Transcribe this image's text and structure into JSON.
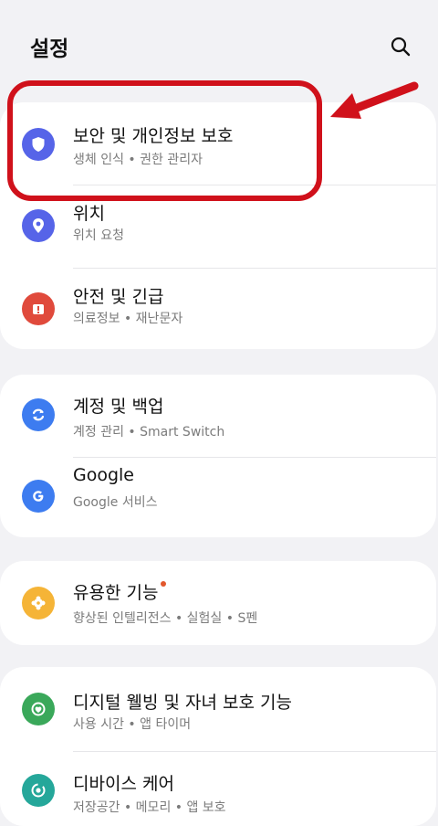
{
  "header": {
    "title": "설정",
    "search_icon": "search-icon"
  },
  "items": [
    {
      "title": "보안 및 개인정보 보호",
      "subtitle": "생체 인식 • 권한 관리자",
      "icon": "shield-icon",
      "color": "#5664e8"
    },
    {
      "title": "위치",
      "subtitle": "위치 요청",
      "icon": "location-pin-icon",
      "color": "#5664e8"
    },
    {
      "title": "안전 및 긴급",
      "subtitle": "의료정보 • 재난문자",
      "icon": "emergency-icon",
      "color": "#e04a3c"
    },
    {
      "title": "계정 및 백업",
      "subtitle": "계정 관리 • Smart Switch",
      "icon": "sync-icon",
      "color": "#3d7cf0"
    },
    {
      "title": "Google",
      "subtitle": "Google 서비스",
      "icon": "google-icon",
      "color": "#3d7cf0"
    },
    {
      "title": "유용한 기능",
      "subtitle": "향상된 인텔리전스 • 실험실 • S펜",
      "icon": "puzzle-icon",
      "color": "#f5b437",
      "badge_color": "#e2572c"
    },
    {
      "title": "디지털 웰빙 및 자녀 보호 기능",
      "subtitle": "사용 시간 • 앱 타이머",
      "icon": "wellbeing-icon",
      "color": "#3aa85a"
    },
    {
      "title": "디바이스 케어",
      "subtitle": "저장공간 • 메모리 • 앱 보호",
      "icon": "device-care-icon",
      "color": "#25a79a"
    }
  ],
  "annotation": {
    "highlight_color": "#d0111b"
  }
}
